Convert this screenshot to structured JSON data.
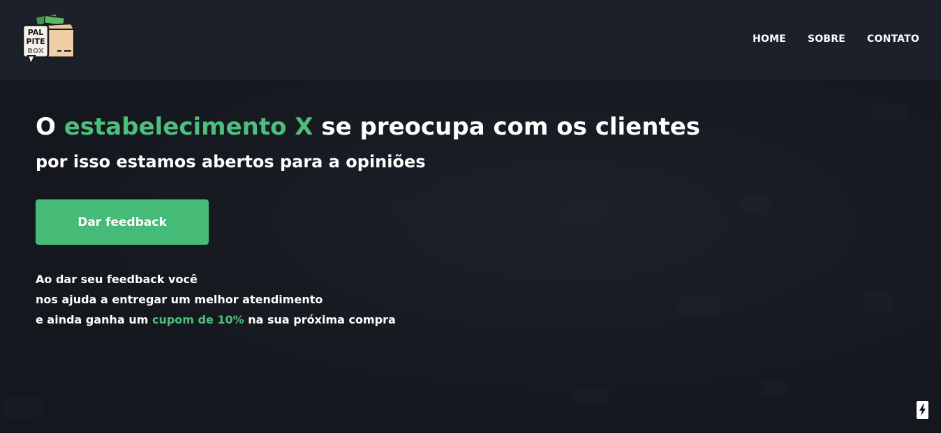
{
  "logo": {
    "line1": "PAL",
    "line2": "PITE",
    "line3": "BOX"
  },
  "nav": {
    "items": [
      "HOME",
      "SOBRE",
      "CONTATO"
    ]
  },
  "hero": {
    "headline_pre": "O ",
    "headline_accent": "estabelecimento X",
    "headline_post": " se preocupa com os clientes",
    "subheadline": "por isso estamos abertos para a opiniões",
    "cta_label": "Dar feedback",
    "desc_line1": "Ao dar seu feedback você",
    "desc_line2": "nos ajuda a entregar um melhor atendimento",
    "desc_line3_pre": "e ainda ganha um ",
    "desc_line3_accent": "cupom de 10%",
    "desc_line3_post": " na sua próxima compra"
  },
  "colors": {
    "accent": "#4dbf7c",
    "button": "#46bb78",
    "navbar": "#1c202b",
    "background": "#15171e"
  },
  "icons": {
    "corner": "lightning-bolt-icon"
  }
}
